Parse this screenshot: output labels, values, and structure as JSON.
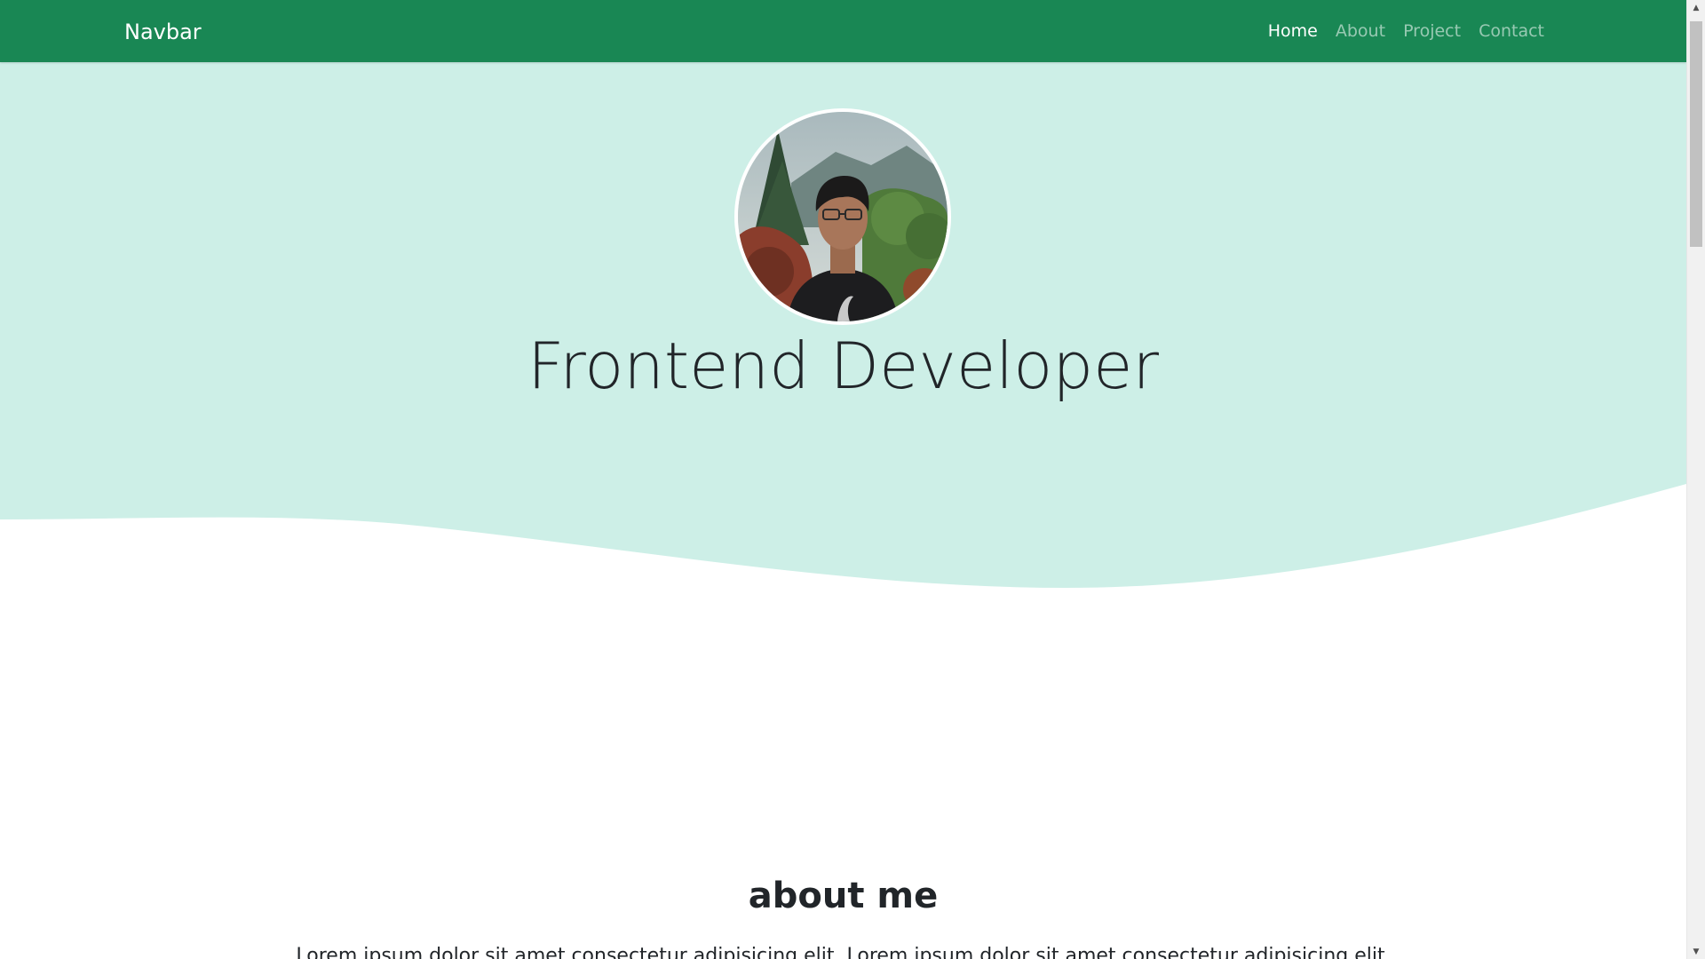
{
  "navbar": {
    "brand": "Navbar",
    "links": [
      {
        "label": "Home",
        "active": true
      },
      {
        "label": "About",
        "active": false
      },
      {
        "label": "Project",
        "active": false
      },
      {
        "label": "Contact",
        "active": false
      }
    ],
    "bg_color": "#198754"
  },
  "hero": {
    "title": "Frontend Developer",
    "bg_color": "#cdefe7",
    "avatar_icon": "profile-photo"
  },
  "about": {
    "title": "about me",
    "text": "Lorem ipsum dolor sit amet consectetur adipisicing elit. Lorem ipsum dolor sit amet consectetur adipisicing elit."
  },
  "scrollbar": {
    "up_icon": "scroll-up-arrow",
    "down_icon": "scroll-down-arrow"
  }
}
